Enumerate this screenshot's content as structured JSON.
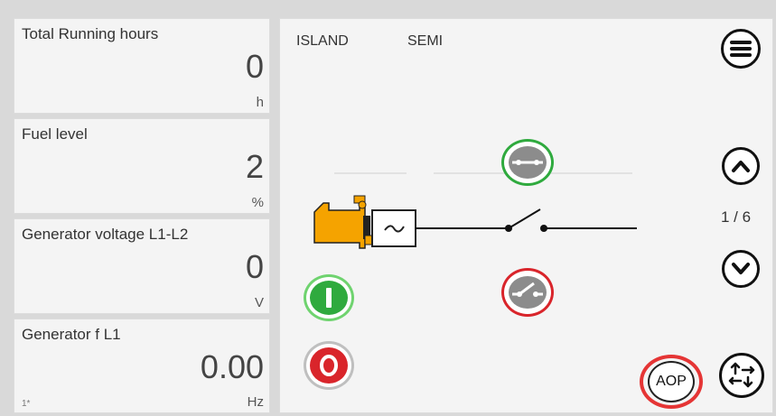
{
  "tiles": [
    {
      "label": "Total Running hours",
      "value": "0",
      "unit": "h"
    },
    {
      "label": "Fuel level",
      "value": "2",
      "unit": "%"
    },
    {
      "label": "Generator voltage L1-L2",
      "value": "0",
      "unit": "V"
    },
    {
      "label": "Generator f L1",
      "value": "0.00",
      "unit": "Hz",
      "corner": "1*"
    }
  ],
  "main": {
    "mode_left": "ISLAND",
    "mode_right": "SEMI",
    "page_indicator": "1 / 6",
    "aop_label": "AOP"
  },
  "icons": {
    "menu": "menu-icon",
    "up": "chevron-up-icon",
    "down": "chevron-down-icon",
    "expand": "expand-arrows-icon",
    "genset": "genset-icon",
    "breaker_close": "breaker-close-icon",
    "breaker_open": "breaker-open-icon",
    "start": "start-icon",
    "stop": "stop-icon"
  },
  "colors": {
    "engine": "#f5a300",
    "green": "#2faa3e",
    "red": "#d9252b",
    "aop_ring": "#e53535"
  }
}
